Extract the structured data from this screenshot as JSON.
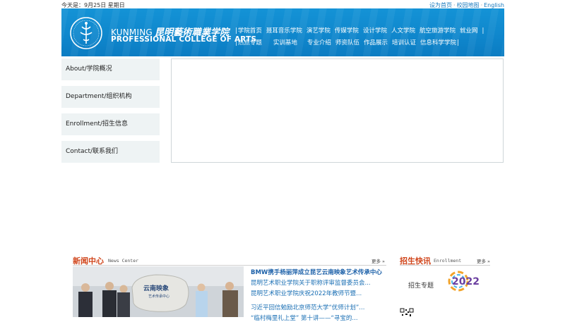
{
  "topbar": {
    "date_text": "今天是：9月25日 星期日",
    "links": [
      "设为首页",
      "校园地图",
      "English"
    ]
  },
  "header": {
    "brand_en_line1": "KUNMING",
    "brand_cn": "昆明藝術職業学院",
    "brand_en_line2": "PROFESSIONAL COLLEGE OF ARTS",
    "logo_icon": "college-emblem-icon",
    "nav_row1": [
      "学院首页",
      "聂耳音乐学院",
      "演艺学院",
      "传媒学院",
      "设计学院",
      "人文学院",
      "航空旅游学院",
      "就业网"
    ],
    "nav_row2": [
      "热点专题",
      "实训基地",
      "专业介绍",
      "师资队伍",
      "作品展示",
      "培训认证",
      "信息科学学院"
    ]
  },
  "sidebar": {
    "items": [
      {
        "label": "About/学院概况"
      },
      {
        "label": "Department/组织机构"
      },
      {
        "label": "Enrollment/招生信息"
      },
      {
        "label": "Contact/联系我们"
      }
    ]
  },
  "news": {
    "title": "新闻中心",
    "subtitle": "News Center",
    "more": "更多",
    "photo_stone_text_1": "云南映象",
    "photo_stone_text_2": "艺术传承中心",
    "items": [
      "BMW携手杨丽萍成立昆艺云南映象艺术传承中心",
      "昆明艺术职业学院关于职称评审监督委员会...",
      "昆明艺术职业学院庆祝2022年教师节暨...",
      "习近平回信勉励北京师范大学“优师计划”...",
      "“临村梅里礼上堂” 第十讲——“寻宝的..."
    ]
  },
  "enrollment": {
    "title": "招生快讯",
    "subtitle": "Enrollment",
    "more": "更多",
    "banner_text": "招生专题",
    "banner_year": "2022"
  },
  "colors": {
    "header_blue": "#1493d6",
    "accent_red": "#d0451b",
    "link_blue": "#1a6fb4",
    "sidebar_bg": "#eef3f4"
  }
}
